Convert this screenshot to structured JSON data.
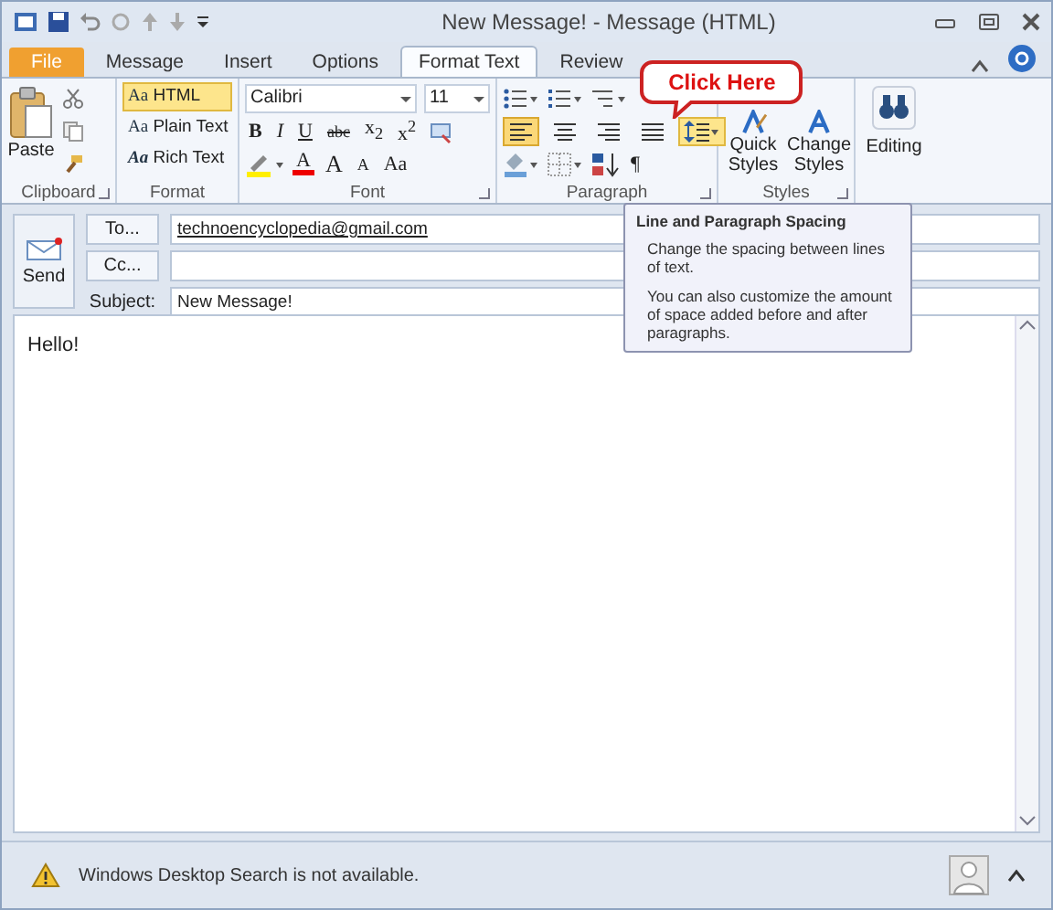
{
  "window": {
    "title": "New Message! - Message (HTML)"
  },
  "tabs": [
    {
      "label": "File",
      "kind": "file",
      "selected": false
    },
    {
      "label": "Message",
      "kind": "tab",
      "selected": false
    },
    {
      "label": "Insert",
      "kind": "tab",
      "selected": false
    },
    {
      "label": "Options",
      "kind": "tab",
      "selected": false
    },
    {
      "label": "Format Text",
      "kind": "tab",
      "selected": true
    },
    {
      "label": "Review",
      "kind": "tab",
      "selected": false
    }
  ],
  "ribbon": {
    "clipboard": {
      "label": "Clipboard",
      "paste": "Paste"
    },
    "format": {
      "label": "Format",
      "options": [
        {
          "icon": "Aa",
          "label": "HTML",
          "selected": true
        },
        {
          "icon": "Aa",
          "label": "Plain Text",
          "selected": false
        },
        {
          "icon": "Aa",
          "label": "Rich Text",
          "selected": false
        }
      ]
    },
    "font": {
      "label": "Font",
      "family": "Calibri",
      "size": "11",
      "styles": [
        "B",
        "I",
        "U",
        "abc",
        "x$_{2}$",
        "x$^{2}$"
      ],
      "color_letter": "A",
      "grow": "A",
      "shrink": "A",
      "case": "Aa"
    },
    "paragraph": {
      "label": "Paragraph",
      "align": [
        {
          "selected": true
        },
        {
          "selected": false
        },
        {
          "selected": false
        },
        {
          "selected": false
        }
      ],
      "line_spacing_hovered": true,
      "show_marks": "¶"
    },
    "styles": {
      "label": "Styles",
      "quick": "Quick Styles",
      "change": "Change Styles"
    },
    "editing": {
      "label": "Editing"
    }
  },
  "callout": "Click Here",
  "tooltip": {
    "title": "Line and Paragraph Spacing",
    "paragraphs": [
      "Change the spacing between lines of text.",
      "You can also customize the amount of space added before and after paragraphs."
    ]
  },
  "header": {
    "send": "Send",
    "to_button": "To...",
    "to": "technoencyclopedia@gmail.com",
    "cc_button": "Cc...",
    "subject_label": "Subject:",
    "subject": "New Message!"
  },
  "body": "Hello!",
  "status": "Windows Desktop Search is not available."
}
